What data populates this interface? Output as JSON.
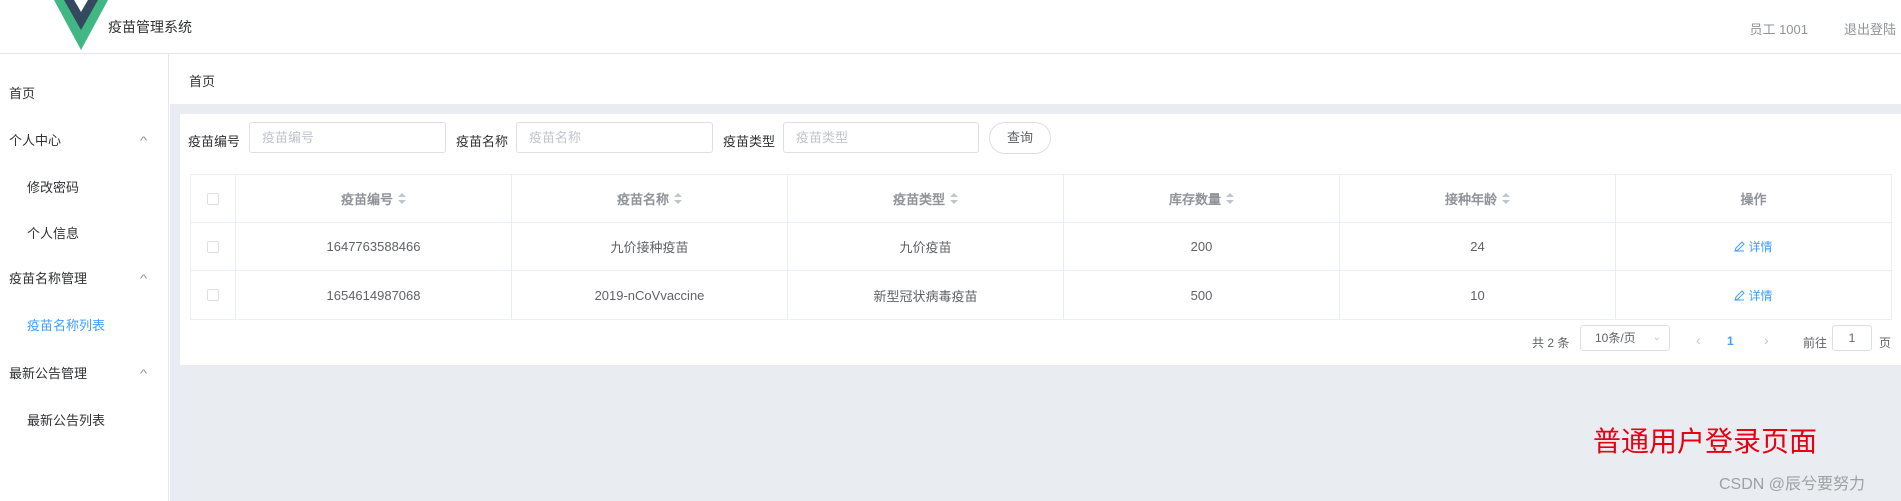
{
  "header": {
    "app_title": "疫苗管理系统",
    "user": "员工 1001",
    "logout": "退出登陆"
  },
  "sidebar": {
    "items": [
      {
        "label": "首页"
      },
      {
        "label": "个人中心"
      },
      {
        "label": "修改密码"
      },
      {
        "label": "个人信息"
      },
      {
        "label": "疫苗名称管理"
      },
      {
        "label": "疫苗名称列表"
      },
      {
        "label": "最新公告管理"
      },
      {
        "label": "最新公告列表"
      }
    ]
  },
  "breadcrumb": "首页",
  "search": {
    "fields": [
      {
        "label": "疫苗编号",
        "placeholder": "疫苗编号"
      },
      {
        "label": "疫苗名称",
        "placeholder": "疫苗名称"
      },
      {
        "label": "疫苗类型",
        "placeholder": "疫苗类型"
      }
    ],
    "button": "查询"
  },
  "table": {
    "columns": [
      "疫苗编号",
      "疫苗名称",
      "疫苗类型",
      "库存数量",
      "接种年龄",
      "操作"
    ],
    "rows": [
      {
        "id": "1647763588466",
        "name": "九价接种疫苗",
        "type": "九价疫苗",
        "stock": "200",
        "age": "24",
        "action": "详情"
      },
      {
        "id": "1654614987068",
        "name": "2019-nCoVvaccine",
        "type": "新型冠状病毒疫苗",
        "stock": "500",
        "age": "10",
        "action": "详情"
      }
    ]
  },
  "pagination": {
    "total": "共 2 条",
    "page_size": "10条/页",
    "current_page": "1",
    "goto_label": "前往",
    "goto_value": "1",
    "page_suffix": "页"
  },
  "watermark": "普通用户登录页面",
  "credit": "CSDN @辰兮要努力",
  "colors": {
    "accent": "#409EFF",
    "watermark": "#e60012",
    "logo_dark": "#35495e",
    "logo_light": "#41b883"
  }
}
